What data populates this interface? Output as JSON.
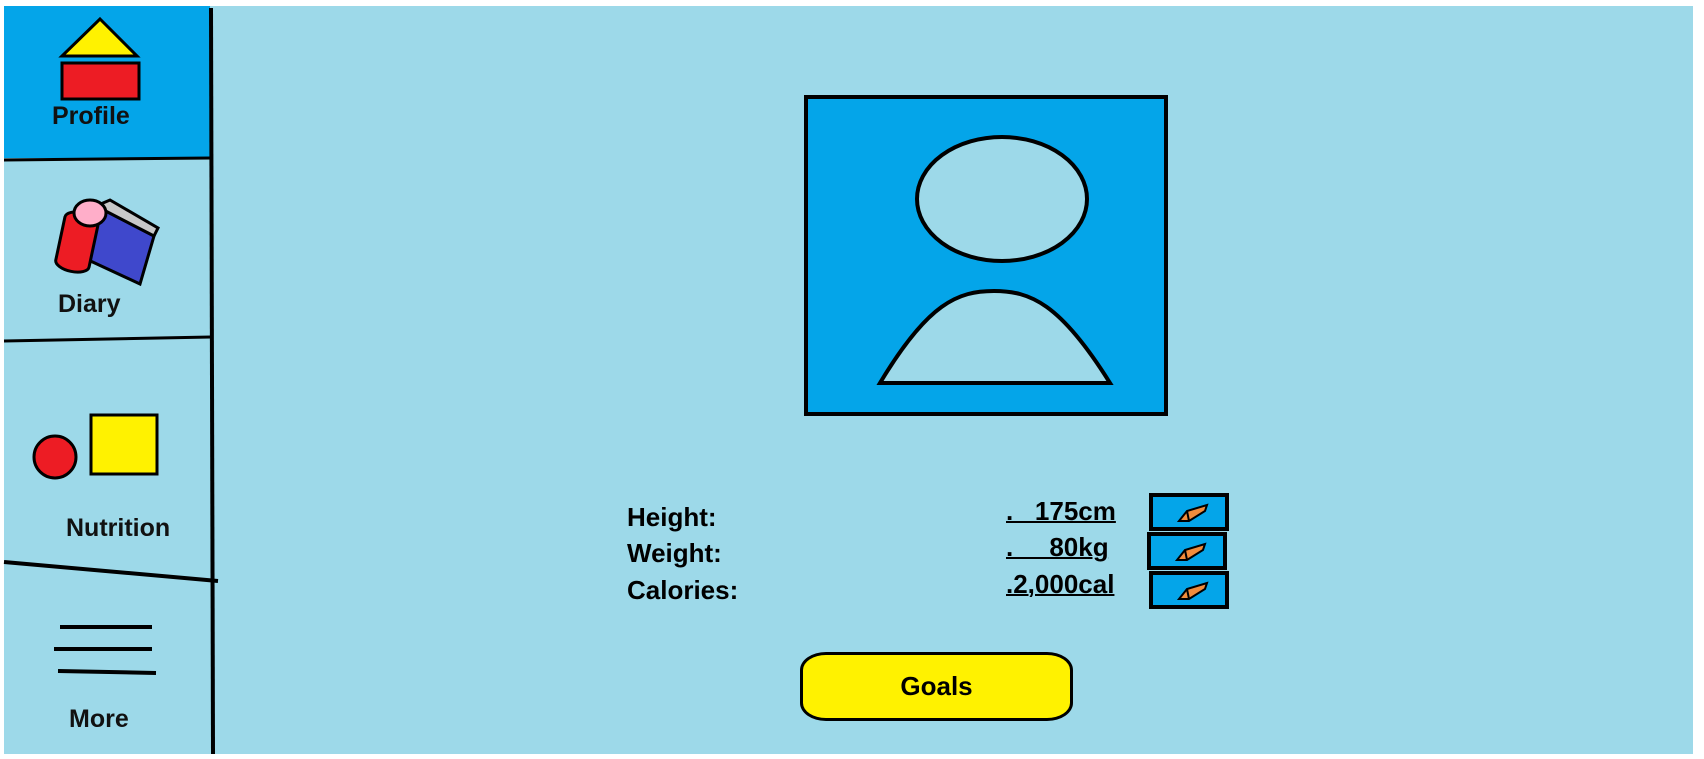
{
  "sidebar": {
    "items": [
      {
        "label": "Profile",
        "icon": "home-icon",
        "active": true
      },
      {
        "label": "Diary",
        "icon": "diary-icon",
        "active": false
      },
      {
        "label": "Nutrition",
        "icon": "nutrition-icon",
        "active": false
      },
      {
        "label": "More",
        "icon": "hamburger-menu-icon",
        "active": false
      }
    ]
  },
  "profile": {
    "avatar_icon": "user-avatar-icon",
    "stats": [
      {
        "label": "Height:",
        "value": ".   175cm",
        "edit_icon": "pencil-icon"
      },
      {
        "label": "Weight:",
        "value": ".     80kg",
        "edit_icon": "pencil-icon"
      },
      {
        "label": "Calories:",
        "value": ".2,000cal",
        "edit_icon": "pencil-icon"
      }
    ],
    "goals_label": "Goals"
  },
  "colors": {
    "background": "#9dd9e9",
    "accent": "#04a5e9",
    "button_yellow": "#fff200",
    "icon_red": "#ed1c24",
    "icon_pink": "#ffaec9",
    "icon_blue": "#3f48cc",
    "pencil_orange": "#f08c3c"
  }
}
